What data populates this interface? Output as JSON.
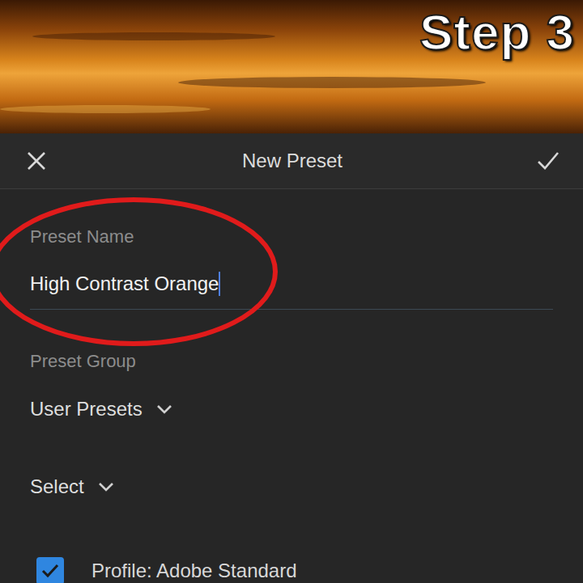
{
  "photo": {
    "caption": "Step 3"
  },
  "header": {
    "title": "New Preset"
  },
  "fields": [
    {
      "kind": "text",
      "label": "Preset Name",
      "value": "High Contrast Orange",
      "focused": true
    },
    {
      "kind": "dropdown",
      "label": "Preset Group",
      "value": "User Presets"
    },
    {
      "kind": "dropdown",
      "label": "",
      "value": "Select"
    }
  ],
  "options": [
    {
      "label": "Profile: Adobe Standard",
      "checked": true
    }
  ]
}
